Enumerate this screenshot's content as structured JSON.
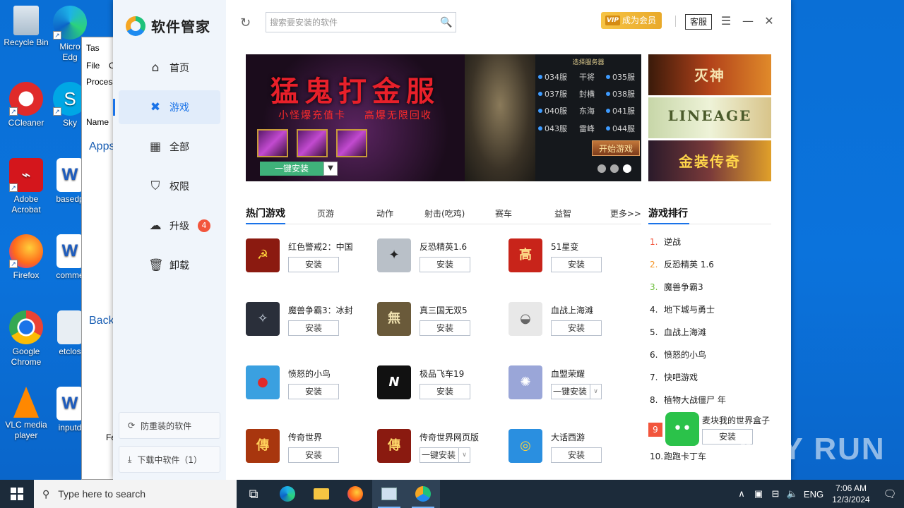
{
  "desktop": {
    "icons": [
      {
        "label": "Recycle Bin"
      },
      {
        "label": "Micro Edg"
      },
      {
        "label": "CCleaner"
      },
      {
        "label": "Sky"
      },
      {
        "label": "Adobe Acrobat"
      },
      {
        "label": "basedp"
      },
      {
        "label": "Firefox"
      },
      {
        "label": "comme"
      },
      {
        "label": "Google Chrome"
      },
      {
        "label": "etclos"
      },
      {
        "label": "VLC media player"
      },
      {
        "label": "inputd"
      }
    ]
  },
  "taskmgr": {
    "title": "Tas",
    "menu_file": "File",
    "menu_c": "C",
    "tab": "Process",
    "col_name": "Name",
    "group_apps": "Apps",
    "group_bg": "Backg",
    "footer": "Fe"
  },
  "app": {
    "name": "软件管家",
    "nav": [
      {
        "label": "首页",
        "icon": "home-icon"
      },
      {
        "label": "游戏",
        "icon": "game-icon"
      },
      {
        "label": "全部",
        "icon": "grid-icon"
      },
      {
        "label": "权限",
        "icon": "shield-icon"
      },
      {
        "label": "升级",
        "icon": "upgrade-icon",
        "badge": "4"
      },
      {
        "label": "卸载",
        "icon": "trash-icon"
      }
    ],
    "side_buttons": {
      "prevent": "防重装的软件",
      "downloading": "下载中软件（1）"
    },
    "search_placeholder": "搜索要安装的软件",
    "vip_tag": "VIP",
    "vip_label": "成为会员",
    "kefu": "客服"
  },
  "banner": {
    "title": "猛鬼打金服",
    "subtitle": "小怪爆充值卡    高爆无限回收",
    "panel_header": "选择服务器",
    "servers": [
      [
        "034服",
        "干将",
        "035服"
      ],
      [
        "037服",
        "封横",
        "038服"
      ],
      [
        "040服",
        "东海",
        "041服"
      ],
      [
        "043服",
        "雷峰",
        "044服"
      ]
    ],
    "play_label": "开始游戏",
    "install_label": "一键安装",
    "slide_count": 3,
    "active_slide": 3
  },
  "thumbs": [
    {
      "text": "灭神"
    },
    {
      "text": "LINEAGE"
    },
    {
      "text": "金装传奇"
    }
  ],
  "tabs": {
    "items": [
      "热门游戏",
      "页游",
      "动作",
      "射击(吃鸡)",
      "赛车",
      "益智"
    ],
    "active": "热门游戏",
    "more": "更多>>"
  },
  "games": [
    {
      "name": "红色警戒2：中国",
      "button": "安装",
      "icon_color": "#8b1a10",
      "glyph": "☭"
    },
    {
      "name": "反恐精英1.6",
      "button": "安装",
      "icon_color": "#b9c0c8",
      "glyph": "✦"
    },
    {
      "name": "51星变",
      "button": "安装",
      "icon_color": "#c8241a",
      "glyph": "高"
    },
    {
      "name": "魔兽争霸3：冰封",
      "button": "安装",
      "icon_color": "#2a2f3a",
      "glyph": "✧"
    },
    {
      "name": "真三国无双5",
      "button": "安装",
      "icon_color": "#6a5a3a",
      "glyph": "無"
    },
    {
      "name": "血战上海滩",
      "button": "安装",
      "icon_color": "#e8e8e8",
      "glyph": "◒"
    },
    {
      "name": "愤怒的小鸟",
      "button": "安装",
      "icon_color": "#3aa0e0",
      "glyph": "●"
    },
    {
      "name": "极品飞车19",
      "button": "安装",
      "icon_color": "#111111",
      "glyph": "N"
    },
    {
      "name": "血盟荣耀",
      "button": "一键安装",
      "split": true,
      "icon_color": "#9aa6d8",
      "glyph": "✺"
    },
    {
      "name": "传奇世界",
      "button": "安装",
      "icon_color": "#a8360e",
      "glyph": "傳"
    },
    {
      "name": "传奇世界网页版",
      "button": "一键安装",
      "split": true,
      "icon_color": "#8a1a10",
      "glyph": "傳"
    },
    {
      "name": "大话西游",
      "button": "安装",
      "icon_color": "#2a8fe0",
      "glyph": "◎"
    }
  ],
  "ranking": {
    "title": "游戏排行",
    "items": [
      {
        "n": "1.",
        "name": "逆战",
        "color": "#f2553c"
      },
      {
        "n": "2.",
        "name": "反恐精英 1.6",
        "color": "#f5962a"
      },
      {
        "n": "3.",
        "name": "魔兽争霸3",
        "color": "#6cbf3a"
      },
      {
        "n": "4.",
        "name": "地下城与勇士",
        "color": "#333333"
      },
      {
        "n": "5.",
        "name": "血战上海滩",
        "color": "#333333"
      },
      {
        "n": "6.",
        "name": "愤怒的小鸟",
        "color": "#333333"
      },
      {
        "n": "7.",
        "name": "快吧游戏",
        "color": "#333333"
      },
      {
        "n": "8.",
        "name": "植物大战僵尸 年",
        "color": "#333333"
      }
    ],
    "featured": {
      "n": "9",
      "name": "麦块我的世界盒子",
      "button": "安装"
    },
    "last": {
      "n": "10.",
      "name": "跑跑卡丁车"
    }
  },
  "watermark": "ANY RUN",
  "taskbar": {
    "search_placeholder": "Type here to search",
    "lang": "ENG",
    "time": "7:06 AM",
    "date": "12/3/2024"
  }
}
